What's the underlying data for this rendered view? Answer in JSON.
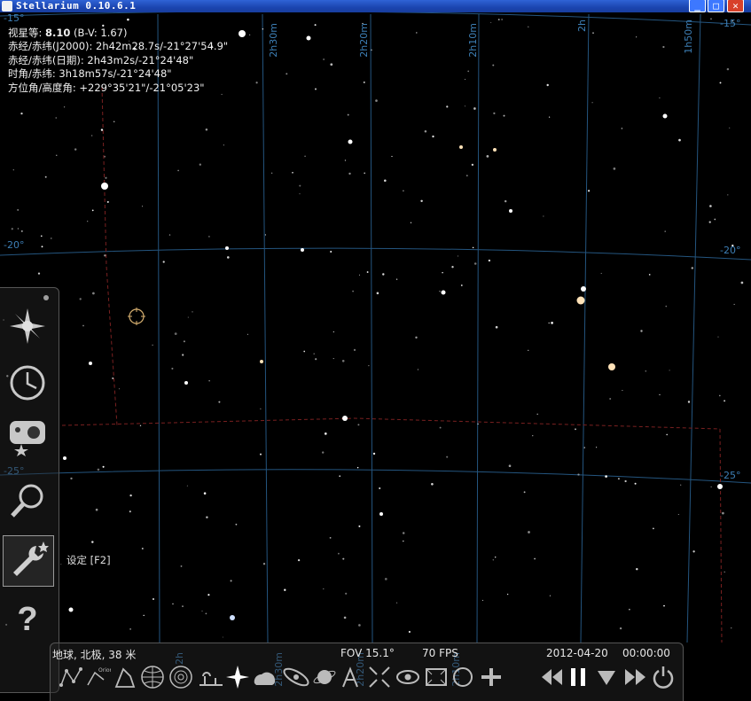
{
  "window": {
    "title": "Stellarium 0.10.6.1"
  },
  "info": {
    "mag_label": "视星等: ",
    "mag_value": "8.10",
    "mag_bv": " (B-V: 1.67)",
    "radec_j2000": "赤经/赤纬(J2000): 2h42m28.7s/-21°27'54.9\"",
    "radec_date": "赤经/赤纬(日期): 2h43m2s/-21°24'48\"",
    "hour_angle": "时角/赤纬: 3h18m57s/-21°24'48\"",
    "azalt": "方位角/高度角: +229°35'21\"/-21°05'23\""
  },
  "grid": {
    "dec_labels": [
      "-15°",
      "-15°",
      "-20°",
      "-20°",
      "-25°",
      "-25°"
    ],
    "ra_labels": [
      "2h30m",
      "2h20m",
      "2h10m",
      "2h",
      "1h50m",
      "2h30m",
      "2h20m",
      "2h10m",
      "2h"
    ]
  },
  "tooltip": "设定  [F2]",
  "status": {
    "location": "地球, 北极, 38 米",
    "fov": "FOV 15.1°",
    "fps": "70 FPS",
    "date": "2012-04-20",
    "time": "00:00:00"
  },
  "icons": {
    "left": [
      "sun-location-icon",
      "clock-icon",
      "sky-viewing-icon",
      "search-icon",
      "settings-icon",
      "help-icon"
    ],
    "bottom": [
      "constellation-lines-icon",
      "constellation-labels-icon",
      "constellation-art-icon",
      "equatorial-grid-icon",
      "azimuthal-grid-icon",
      "ground-icon",
      "cardinal-points-icon",
      "atmosphere-icon",
      "nebulae-icon",
      "planet-hint-icon",
      "mount-icon",
      "center-object-icon",
      "night-mode-icon",
      "full-screen-icon",
      "ocular-icon",
      "telescope-icon",
      "rewind-icon",
      "pause-icon",
      "real-time-icon",
      "forward-icon",
      "quit-icon"
    ]
  },
  "colors": {
    "grid": "#2a5e8a",
    "constellation_boundary": "#7a2020",
    "title_bar": "#1f4fc2"
  }
}
